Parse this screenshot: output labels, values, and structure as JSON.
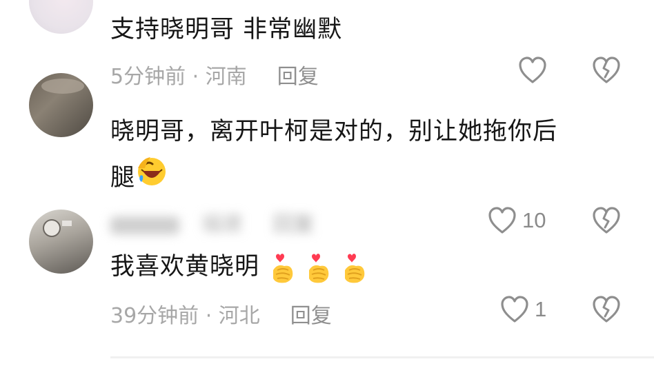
{
  "comments": [
    {
      "text": "支持晓明哥  非常幽默",
      "meta": "5分钟前 · 河南",
      "reply": "回复",
      "likes": ""
    },
    {
      "text_line1": "晓明哥，离开叶柯是对的，别让她拖你后",
      "text_line2": "腿",
      "meta": "福建",
      "reply": "回复",
      "likes": "10"
    },
    {
      "text": "我喜欢黄晓明",
      "meta": "39分钟前 · 河北",
      "reply": "回复",
      "likes": "1"
    }
  ],
  "icons": {
    "like": "heart-outline-icon",
    "dislike": "broken-heart-outline-icon",
    "emoji_laugh": "rolling-laughing-emoji",
    "emoji_heart_hand": "finger-heart-emoji"
  },
  "colors": {
    "text": "#161616",
    "meta": "#a7a7a7",
    "icon": "#8e8e8e"
  }
}
